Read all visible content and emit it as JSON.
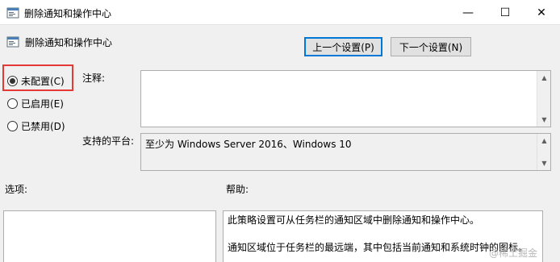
{
  "window": {
    "title": "删除通知和操作中心",
    "minimize_glyph": "—",
    "maximize_glyph": "☐",
    "close_glyph": "✕"
  },
  "header": {
    "title": "删除通知和操作中心"
  },
  "nav": {
    "prev_label": "上一个设置(P)",
    "next_label": "下一个设置(N)"
  },
  "radios": [
    {
      "label": "未配置(C)",
      "checked": true
    },
    {
      "label": "已启用(E)",
      "checked": false
    },
    {
      "label": "已禁用(D)",
      "checked": false
    }
  ],
  "labels": {
    "comment": "注释:",
    "supported": "支持的平台:",
    "options": "选项:",
    "help": "帮助:"
  },
  "comment_value": "",
  "supported_value": "至少为 Windows Server 2016、Windows 10",
  "help_lines": [
    "此策略设置可从任务栏的通知区域中删除通知和操作中心。",
    "",
    "通知区域位于任务栏的最远端，其中包括当前通知和系统时钟的图标。"
  ],
  "watermark": "@稀土掘金",
  "icons": [
    "app-icon",
    "policy-icon",
    "scroll-up-icon",
    "scroll-down-icon"
  ]
}
